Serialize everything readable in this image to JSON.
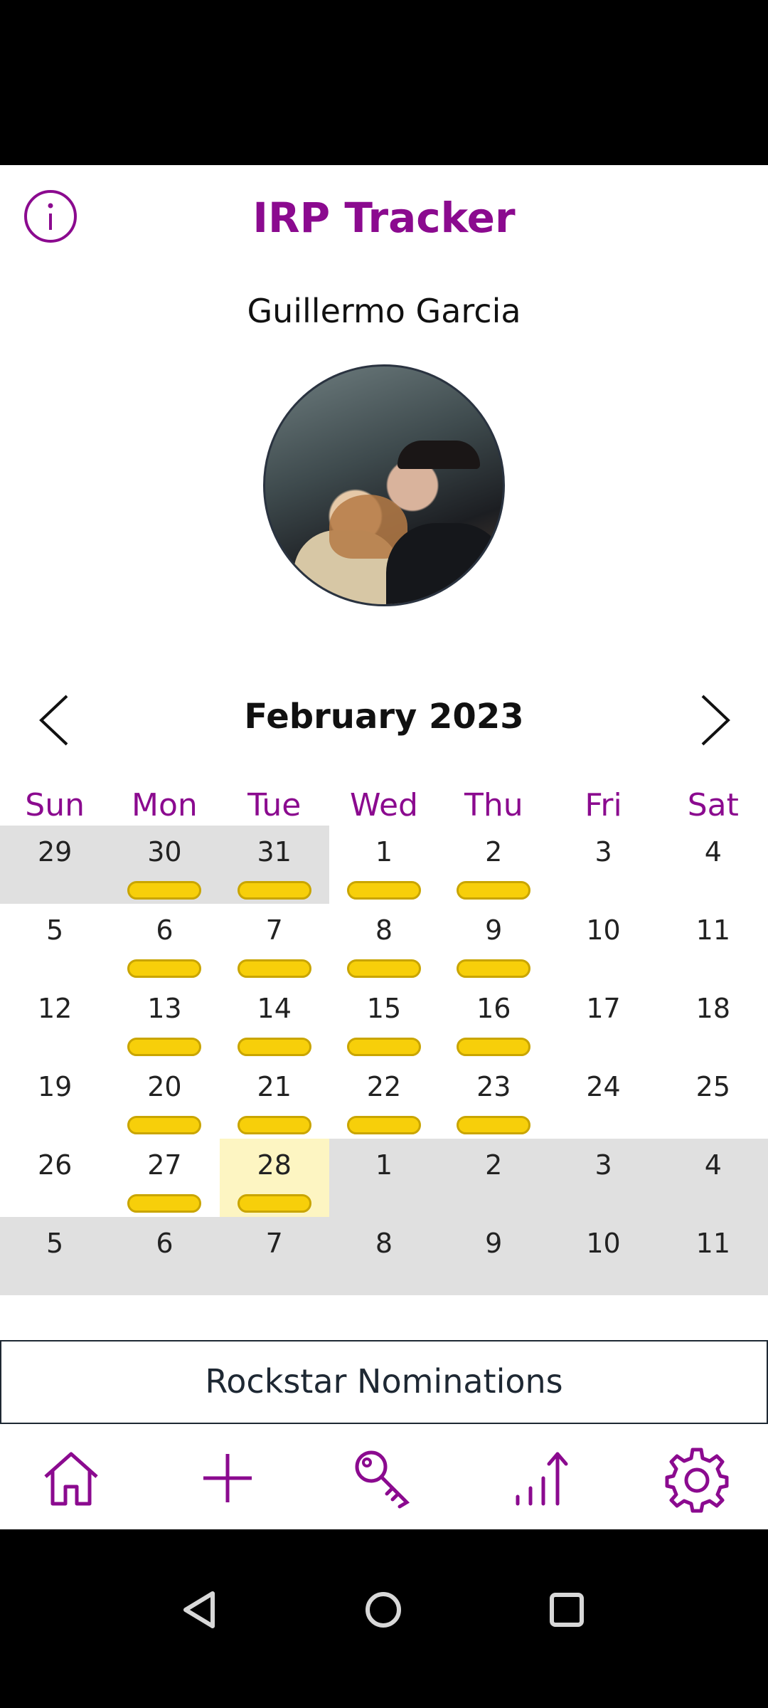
{
  "app": {
    "title": "IRP Tracker",
    "accent_color": "#8b0a8f"
  },
  "header": {
    "info_icon": "info-icon"
  },
  "profile": {
    "name": "Guillermo Garcia",
    "avatar_icon": "profile-photo"
  },
  "calendar": {
    "month_label": "February 2023",
    "weekdays": [
      "Sun",
      "Mon",
      "Tue",
      "Wed",
      "Thu",
      "Fri",
      "Sat"
    ],
    "weeks": [
      [
        {
          "d": "29",
          "m": true
        },
        {
          "d": "30",
          "m": true,
          "e": true
        },
        {
          "d": "31",
          "m": true,
          "e": true
        },
        {
          "d": "1",
          "e": true
        },
        {
          "d": "2",
          "e": true
        },
        {
          "d": "3"
        },
        {
          "d": "4"
        }
      ],
      [
        {
          "d": "5"
        },
        {
          "d": "6",
          "e": true
        },
        {
          "d": "7",
          "e": true
        },
        {
          "d": "8",
          "e": true
        },
        {
          "d": "9",
          "e": true
        },
        {
          "d": "10"
        },
        {
          "d": "11"
        }
      ],
      [
        {
          "d": "12"
        },
        {
          "d": "13",
          "e": true
        },
        {
          "d": "14",
          "e": true
        },
        {
          "d": "15",
          "e": true
        },
        {
          "d": "16",
          "e": true
        },
        {
          "d": "17"
        },
        {
          "d": "18"
        }
      ],
      [
        {
          "d": "19"
        },
        {
          "d": "20",
          "e": true
        },
        {
          "d": "21",
          "e": true
        },
        {
          "d": "22",
          "e": true
        },
        {
          "d": "23",
          "e": true
        },
        {
          "d": "24"
        },
        {
          "d": "25"
        }
      ],
      [
        {
          "d": "26"
        },
        {
          "d": "27",
          "e": true
        },
        {
          "d": "28",
          "e": true,
          "t": true
        },
        {
          "d": "1",
          "m": true
        },
        {
          "d": "2",
          "m": true
        },
        {
          "d": "3",
          "m": true
        },
        {
          "d": "4",
          "m": true
        }
      ],
      [
        {
          "d": "5",
          "m": true
        },
        {
          "d": "6",
          "m": true
        },
        {
          "d": "7",
          "m": true
        },
        {
          "d": "8",
          "m": true
        },
        {
          "d": "9",
          "m": true
        },
        {
          "d": "10",
          "m": true
        },
        {
          "d": "11",
          "m": true
        }
      ]
    ],
    "entry_color": "#f7cf0a",
    "today_color": "#fdf5c2"
  },
  "rockstar_button": {
    "label": "Rockstar Nominations"
  },
  "tabbar": {
    "items": [
      "home-icon",
      "plus-icon",
      "key-icon",
      "chart-icon",
      "gear-icon"
    ]
  }
}
